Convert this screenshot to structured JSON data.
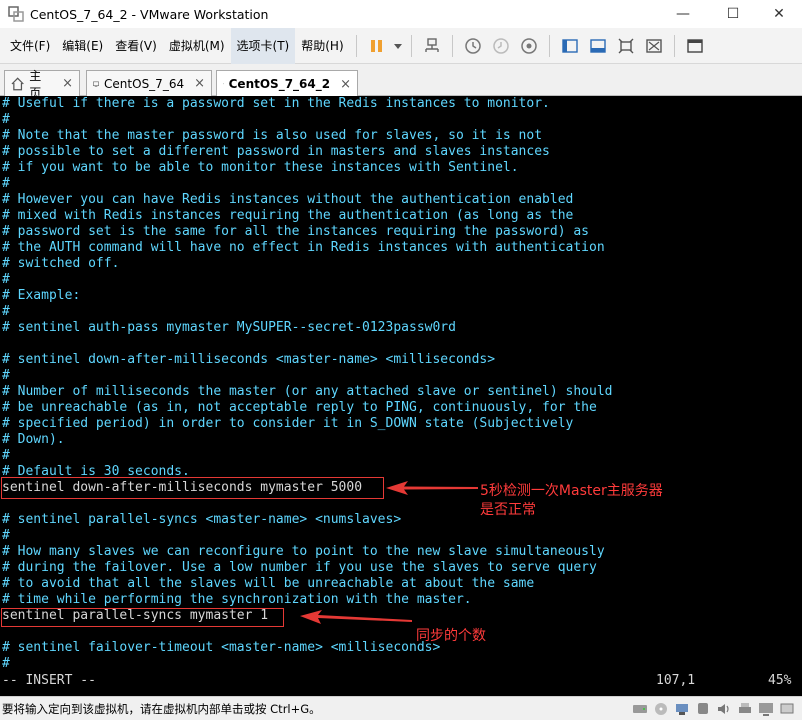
{
  "window": {
    "title": "CentOS_7_64_2 - VMware Workstation",
    "minimize_glyph": "—",
    "maximize_glyph": "☐",
    "close_glyph": "✕"
  },
  "menu": {
    "items": [
      "文件(F)",
      "编辑(E)",
      "查看(V)",
      "虚拟机(M)",
      "选项卡(T)",
      "帮助(H)"
    ]
  },
  "tabs": [
    {
      "label": "主页",
      "close": "×"
    },
    {
      "label": "CentOS_7_64",
      "close": "×"
    },
    {
      "label": "CentOS_7_64_2",
      "close": "×"
    }
  ],
  "terminal": {
    "lines": [
      "# Useful if there is a password set in the Redis instances to monitor.",
      "#",
      "# Note that the master password is also used for slaves, so it is not",
      "# possible to set a different password in masters and slaves instances",
      "# if you want to be able to monitor these instances with Sentinel.",
      "#",
      "# However you can have Redis instances without the authentication enabled",
      "# mixed with Redis instances requiring the authentication (as long as the",
      "# password set is the same for all the instances requiring the password) as",
      "# the AUTH command will have no effect in Redis instances with authentication",
      "# switched off.",
      "#",
      "# Example:",
      "#",
      "# sentinel auth-pass mymaster MySUPER--secret-0123passw0rd",
      "",
      "# sentinel down-after-milliseconds <master-name> <milliseconds>",
      "#",
      "# Number of milliseconds the master (or any attached slave or sentinel) should",
      "# be unreachable (as in, not acceptable reply to PING, continuously, for the",
      "# specified period) in order to consider it in S_DOWN state (Subjectively",
      "# Down).",
      "#",
      "# Default is 30 seconds.",
      "sentinel down-after-milliseconds mymaster 5000",
      "",
      "# sentinel parallel-syncs <master-name> <numslaves>",
      "#",
      "# How many slaves we can reconfigure to point to the new slave simultaneously",
      "# during the failover. Use a low number if you use the slaves to serve query",
      "# to avoid that all the slaves will be unreachable at about the same",
      "# time while performing the synchronization with the master.",
      "sentinel parallel-syncs mymaster 1",
      "",
      "# sentinel failover-timeout <master-name> <milliseconds>",
      "#"
    ],
    "mode": "-- INSERT --",
    "position": "107,1",
    "percent": "45%"
  },
  "annotations": {
    "first_line1": "5秒检测一次Master主服务器",
    "first_line2": "是否正常",
    "second": "同步的个数"
  },
  "statusbar": {
    "message": "要将输入定向到该虚拟机，请在虚拟机内部单击或按 Ctrl+G。"
  },
  "colors": {
    "terminal_bg": "#000000",
    "comment_cyan": "#5fd7ff",
    "text_white": "#d7d7d7",
    "annotation_red": "#ff3b3b"
  }
}
